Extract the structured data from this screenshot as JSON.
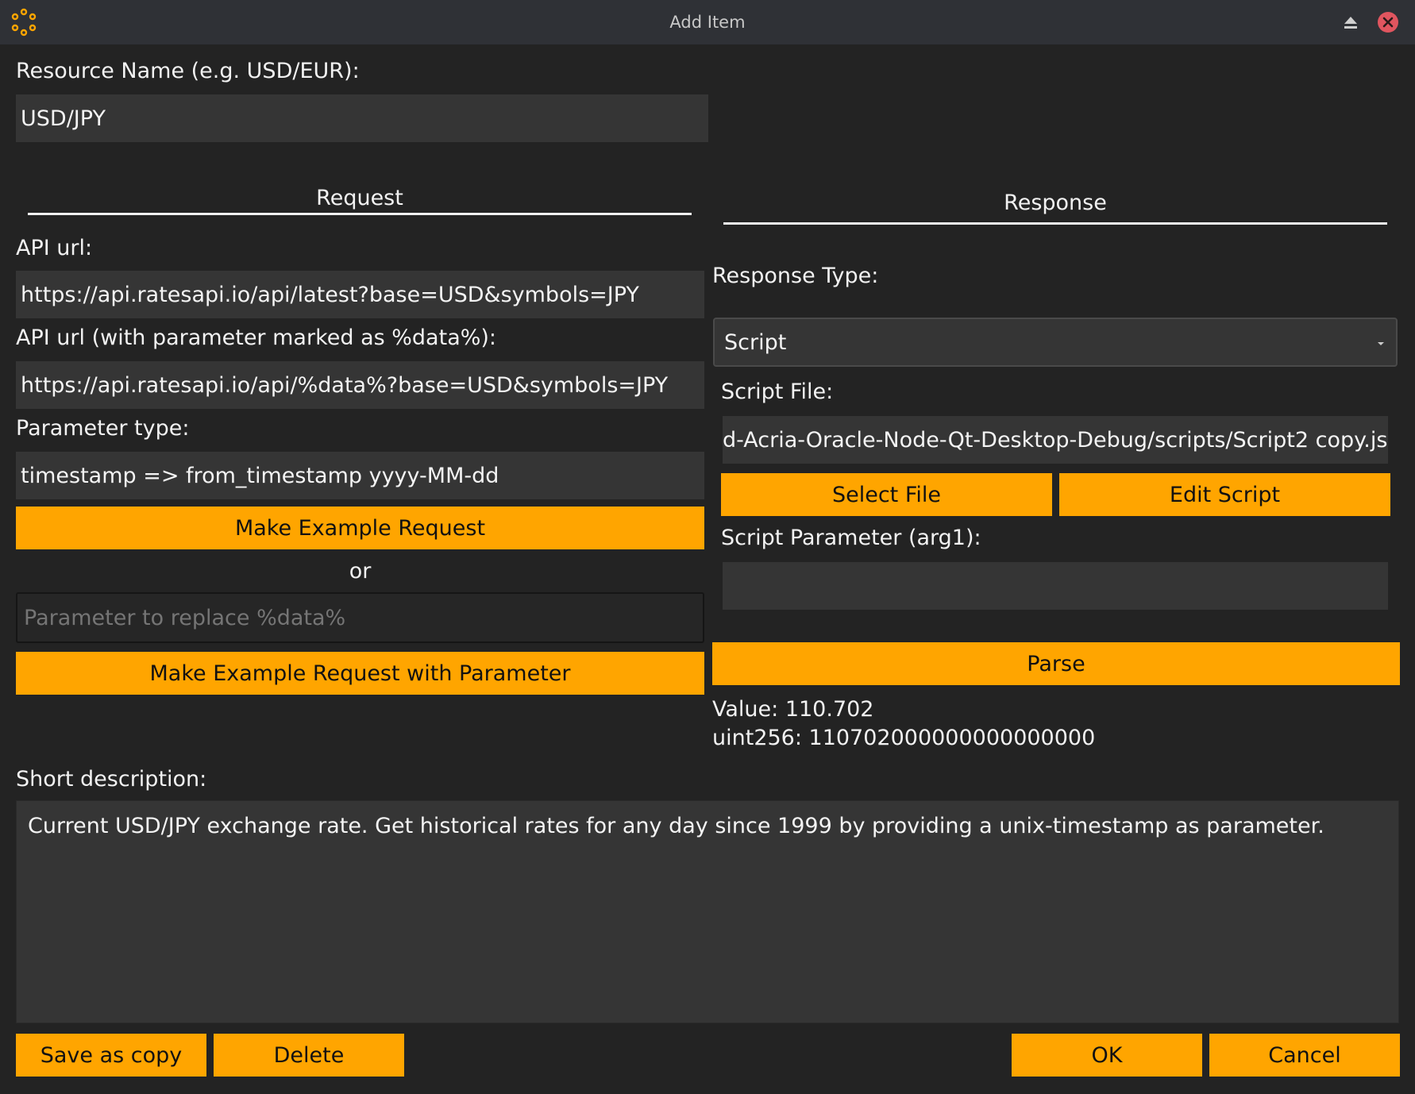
{
  "window": {
    "title": "Add Item",
    "app_icon": "flower-dots-icon",
    "shade_icon": "eject-icon",
    "close_icon": "close-icon"
  },
  "resource": {
    "label": "Resource Name (e.g. USD/EUR):",
    "value": "USD/JPY"
  },
  "request": {
    "heading": "Request",
    "api_url_label": "API url:",
    "api_url_value": "https://api.ratesapi.io/api/latest?base=USD&symbols=JPY",
    "api_url_param_label": "API url (with parameter marked as %data%):",
    "api_url_param_value": "https://api.ratesapi.io/api/%data%?base=USD&symbols=JPY",
    "param_type_label": "Parameter type:",
    "param_type_value": "timestamp => from_timestamp yyyy-MM-dd",
    "make_example_button": "Make Example Request",
    "or_text": "or",
    "param_placeholder": "Parameter to replace %data%",
    "make_example_param_button": "Make Example Request with Parameter"
  },
  "response": {
    "heading": "Response",
    "type_label": "Response Type:",
    "type_value": "Script",
    "script_file_label": "Script File:",
    "script_file_value": "d-Acria-Oracle-Node-Qt-Desktop-Debug/scripts/Script2 copy.js",
    "select_file_button": "Select File",
    "edit_script_button": "Edit Script",
    "script_param_label": "Script Parameter (arg1):",
    "script_param_value": "",
    "parse_button": "Parse",
    "value_text": "Value: 110.702",
    "uint_text": "uint256: 110702000000000000000"
  },
  "description": {
    "label": "Short description:",
    "value": "Current USD/JPY exchange rate. Get historical rates for any day since 1999 by providing a unix-timestamp as parameter."
  },
  "footer": {
    "save_copy": "Save as copy",
    "delete": "Delete",
    "ok": "OK",
    "cancel": "Cancel"
  },
  "colors": {
    "accent": "#ffa500",
    "background": "#232323",
    "field": "#353535",
    "close": "#e0555f"
  }
}
